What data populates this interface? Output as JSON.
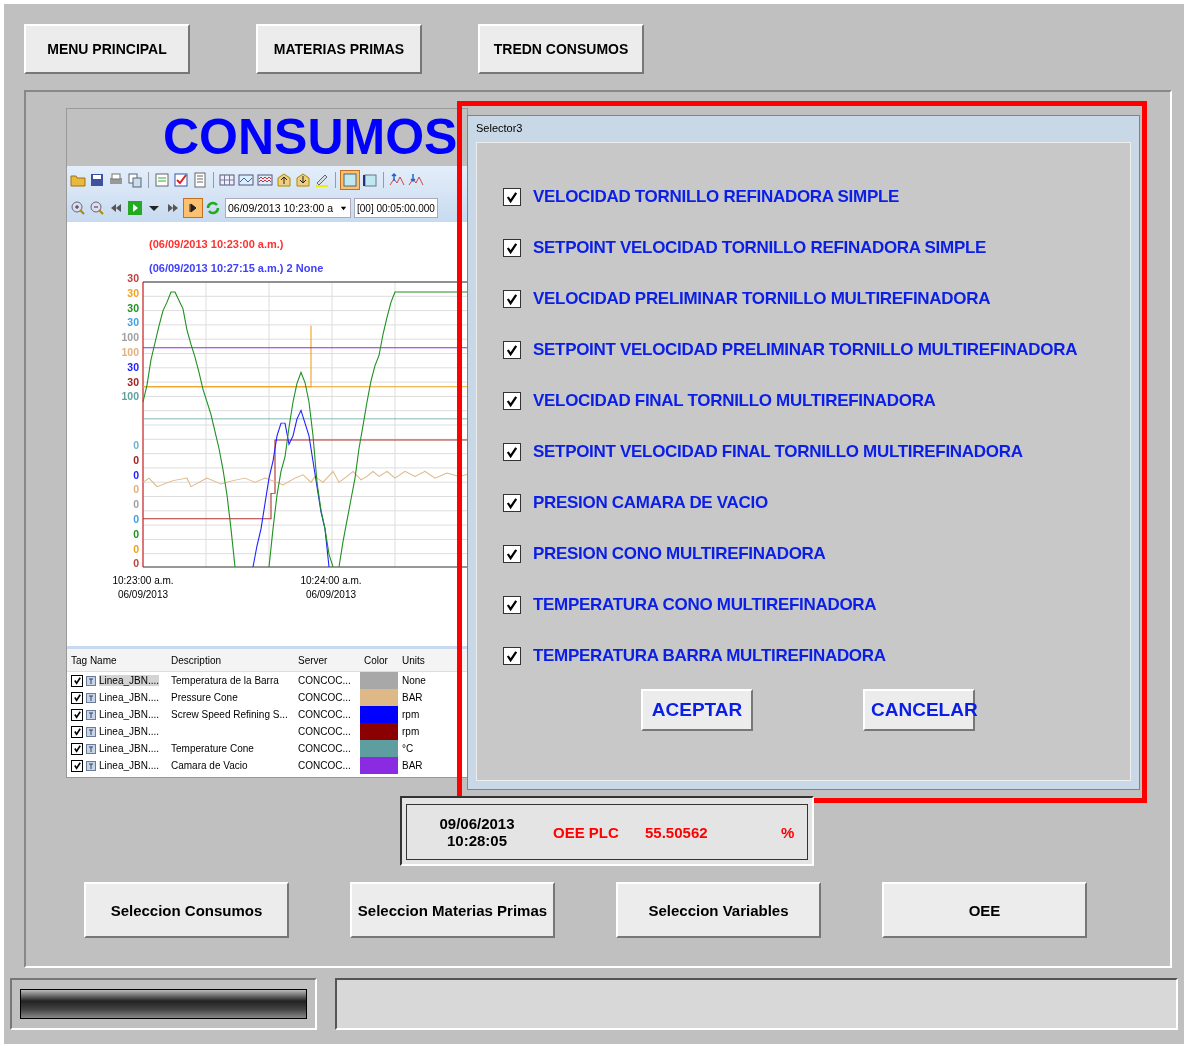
{
  "nav_buttons": [
    "MENU PRINCIPAL",
    "MATERIAS PRIMAS",
    "TREDN CONSUMOS"
  ],
  "trend": {
    "title": "CONSUMOS",
    "time_field": "06/09/2013 10:23:00 a",
    "duration_field": "[00] 00:05:00.000",
    "cursor_labels": [
      {
        "text": "(06/09/2013 10:23:00 a.m.)",
        "color": "#ff3030"
      },
      {
        "text": "(06/09/2013 10:27:15 a.m.) 2 None",
        "color": "#4040ff"
      }
    ],
    "axis_labels": [
      {
        "text": "30",
        "color": "#c04040"
      },
      {
        "text": "30",
        "color": "#f0a020"
      },
      {
        "text": "30",
        "color": "#209020"
      },
      {
        "text": "30",
        "color": "#40a0e0"
      },
      {
        "text": "100",
        "color": "#a0a0a0"
      },
      {
        "text": "100",
        "color": "#e0b080"
      },
      {
        "text": "30",
        "color": "#2020ff"
      },
      {
        "text": "30",
        "color": "#a02020"
      },
      {
        "text": "100",
        "color": "#60a0a0"
      },
      {
        "text": "0",
        "color": "#70b0d0"
      },
      {
        "text": "0",
        "color": "#a02020"
      },
      {
        "text": "0",
        "color": "#2020ff"
      },
      {
        "text": "0",
        "color": "#e0b080"
      },
      {
        "text": "0",
        "color": "#a0a0a0"
      },
      {
        "text": "0",
        "color": "#40a0e0"
      },
      {
        "text": "0",
        "color": "#209020"
      },
      {
        "text": "0",
        "color": "#f0a020"
      },
      {
        "text": "0",
        "color": "#c04040"
      }
    ],
    "time_labels": [
      {
        "time": "10:23:00 a.m.",
        "date": "06/09/2013"
      },
      {
        "time": "10:24:00 a.m.",
        "date": "06/09/2013"
      }
    ],
    "legend": {
      "columns": [
        "Tag Name",
        "Description",
        "Server",
        "Color",
        "Units"
      ],
      "rows": [
        {
          "checked": true,
          "tag": "Linea_JBN....",
          "description": "Temperatura de la Barra",
          "server": "CONCOC...",
          "color": "#a8a8a8",
          "units": "None",
          "selected": true
        },
        {
          "checked": true,
          "tag": "Linea_JBN....",
          "description": "Pressure Cone",
          "server": "CONCOC...",
          "color": "#deb887",
          "units": "BAR",
          "selected": false
        },
        {
          "checked": true,
          "tag": "Linea_JBN....",
          "description": "Screw Speed Refining S...",
          "server": "CONCOC...",
          "color": "#0000ff",
          "units": "rpm",
          "selected": false
        },
        {
          "checked": true,
          "tag": "Linea_JBN....",
          "server": "CONCOC...",
          "color": "#8b0000",
          "units": "rpm",
          "selected": false
        },
        {
          "checked": true,
          "tag": "Linea_JBN....",
          "description": "Temperature Cone",
          "server": "CONCOC...",
          "color": "#5f9ea0",
          "units": "°C",
          "selected": false
        },
        {
          "checked": true,
          "tag": "Linea_JBN....",
          "description": "Camara de Vacio",
          "server": "CONCOC...",
          "color": "#8a2be2",
          "units": "BAR",
          "selected": false
        }
      ]
    }
  },
  "dialog": {
    "title": "Selector3",
    "items": [
      {
        "label": "VELOCIDAD TORNILLO REFINADORA SIMPLE",
        "checked": true
      },
      {
        "label": "SETPOINT VELOCIDAD TORNILLO REFINADORA SIMPLE",
        "checked": true
      },
      {
        "label": "VELOCIDAD PRELIMINAR TORNILLO MULTIREFINADORA",
        "checked": true
      },
      {
        "label": "SETPOINT VELOCIDAD PRELIMINAR TORNILLO MULTIREFINADORA",
        "checked": true
      },
      {
        "label": "VELOCIDAD FINAL TORNILLO MULTIREFINADORA",
        "checked": true
      },
      {
        "label": "SETPOINT VELOCIDAD FINAL TORNILLO MULTIREFINADORA",
        "checked": true
      },
      {
        "label": "PRESION CAMARA DE VACIO",
        "checked": true
      },
      {
        "label": "PRESION CONO MULTIREFINADORA",
        "checked": true
      },
      {
        "label": "TEMPERATURA CONO MULTIREFINADORA",
        "checked": true
      },
      {
        "label": "TEMPERATURA BARRA MULTIREFINADORA",
        "checked": true
      }
    ],
    "buttons": [
      "ACEPTAR",
      "CANCELAR"
    ]
  },
  "oee": {
    "date": "09/06/2013",
    "time": "10:28:05",
    "label": "OEE PLC",
    "value": "55.50562",
    "unit": "%"
  },
  "bottom_buttons": [
    "Seleccion Consumos",
    "Seleccion Materias Primas",
    "Seleccion Variables",
    "OEE"
  ]
}
